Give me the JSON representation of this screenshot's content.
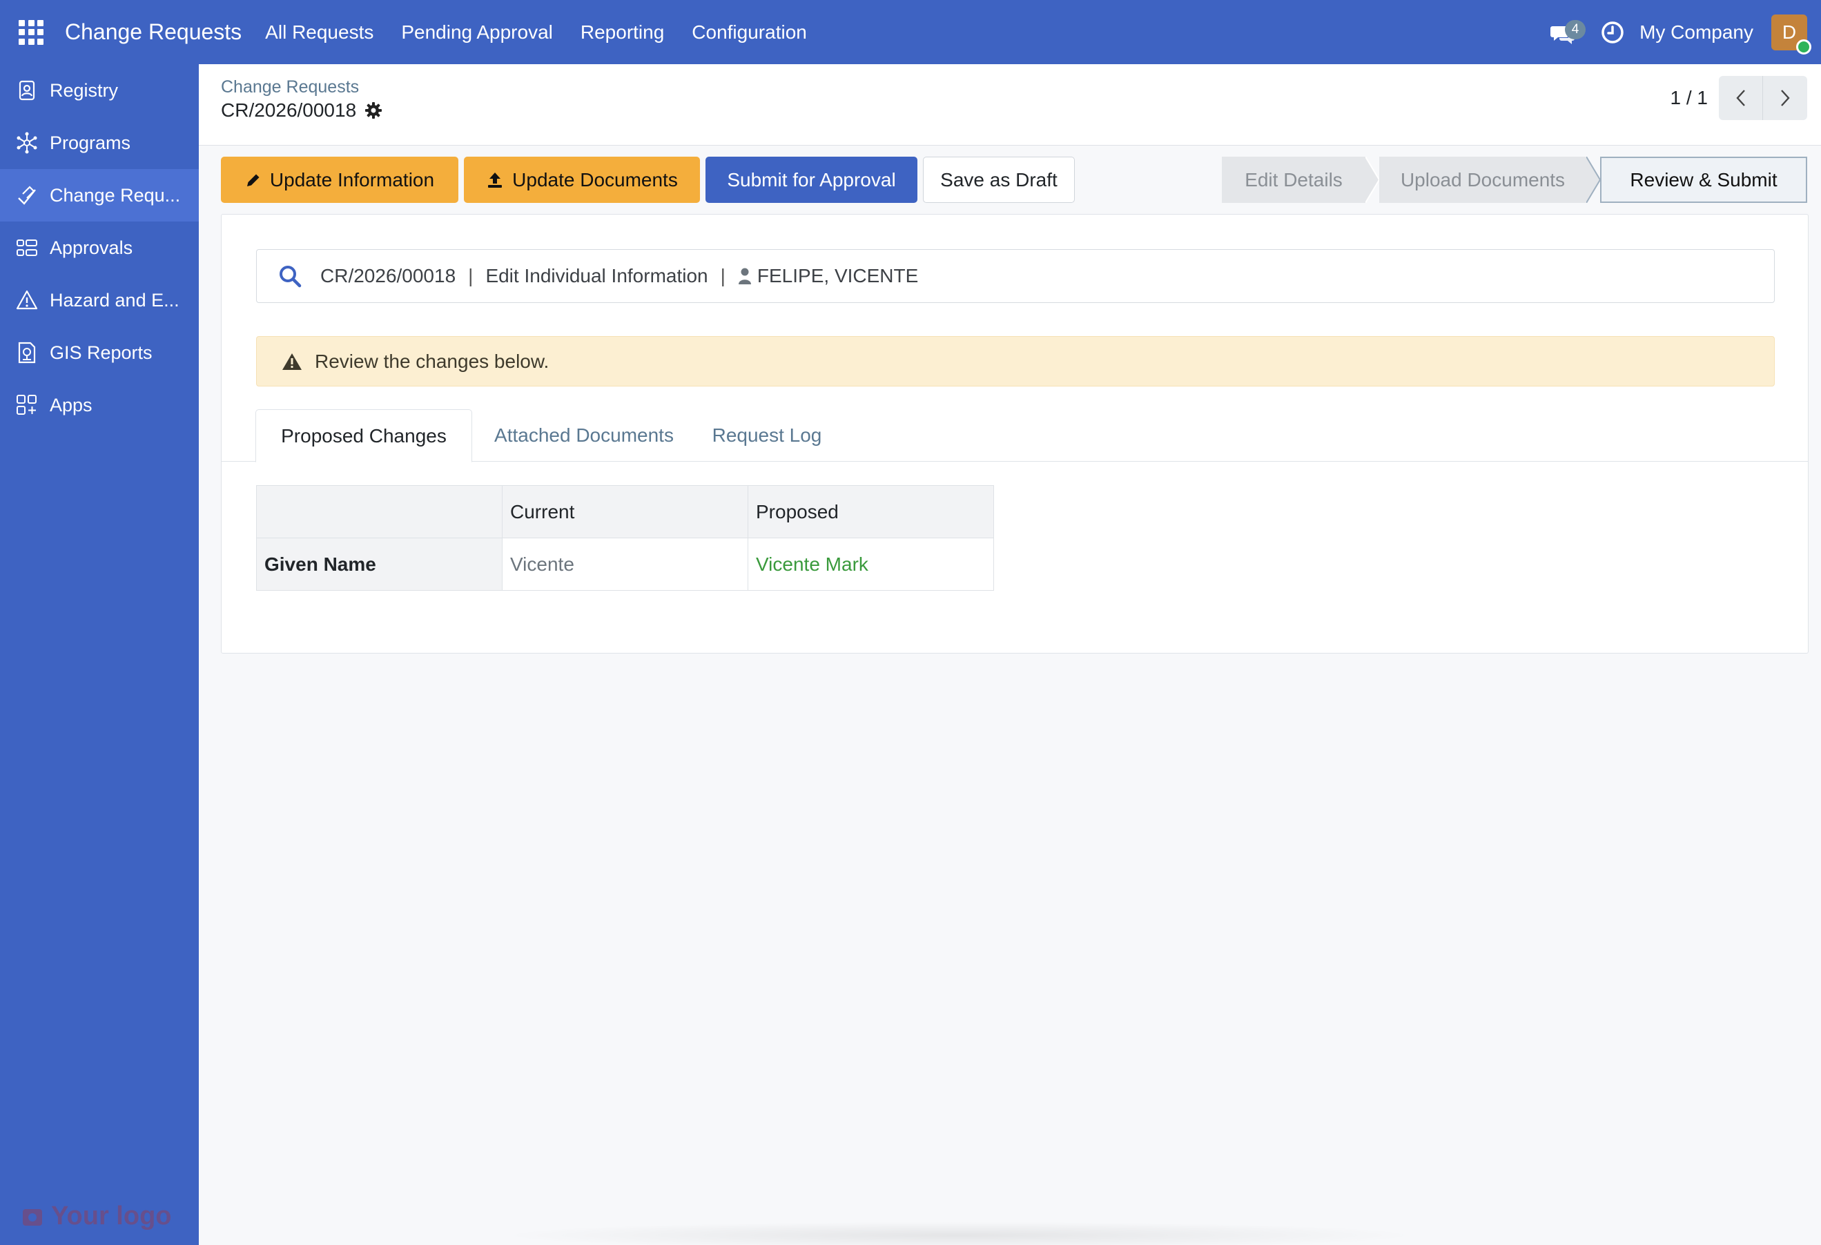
{
  "navbar": {
    "app_title": "Change Requests",
    "menu": [
      "All Requests",
      "Pending Approval",
      "Reporting",
      "Configuration"
    ],
    "messages_count": "4",
    "company": "My Company",
    "avatar_initial": "D"
  },
  "sidebar": {
    "items": [
      {
        "label": "Registry",
        "icon": "registry-icon"
      },
      {
        "label": "Programs",
        "icon": "programs-icon"
      },
      {
        "label": "Change Requ...",
        "icon": "change-requests-icon",
        "active": true
      },
      {
        "label": "Approvals",
        "icon": "approvals-icon"
      },
      {
        "label": "Hazard and E...",
        "icon": "hazard-icon"
      },
      {
        "label": "GIS Reports",
        "icon": "gis-reports-icon"
      },
      {
        "label": "Apps",
        "icon": "apps-icon"
      }
    ],
    "logo_text": "Your logo"
  },
  "control": {
    "breadcrumb_parent": "Change Requests",
    "record_name": "CR/2026/00018",
    "pager": "1 / 1"
  },
  "buttons": {
    "update_information": "Update Information",
    "update_documents": "Update Documents",
    "submit_for_approval": "Submit for Approval",
    "save_as_draft": "Save as Draft"
  },
  "statusbar": {
    "stages": [
      "Edit Details",
      "Upload Documents",
      "Review & Submit"
    ],
    "current": "Review & Submit"
  },
  "summary": {
    "reference": "CR/2026/00018",
    "separator": "|",
    "request_type": "Edit Individual Information",
    "individual": "FELIPE, VICENTE"
  },
  "alert": {
    "text": "Review the changes below."
  },
  "tabs": [
    "Proposed Changes",
    "Attached Documents",
    "Request Log"
  ],
  "changes_table": {
    "headers": [
      "",
      "Current",
      "Proposed"
    ],
    "rows": [
      {
        "field": "Given Name",
        "current": "Vicente",
        "proposed": "Vicente Mark"
      }
    ]
  },
  "colors": {
    "brand": "#3e63c2",
    "warning_button": "#f4ae3c",
    "proposed_text": "#3a9a3c",
    "alert_bg": "#fcefd2"
  }
}
